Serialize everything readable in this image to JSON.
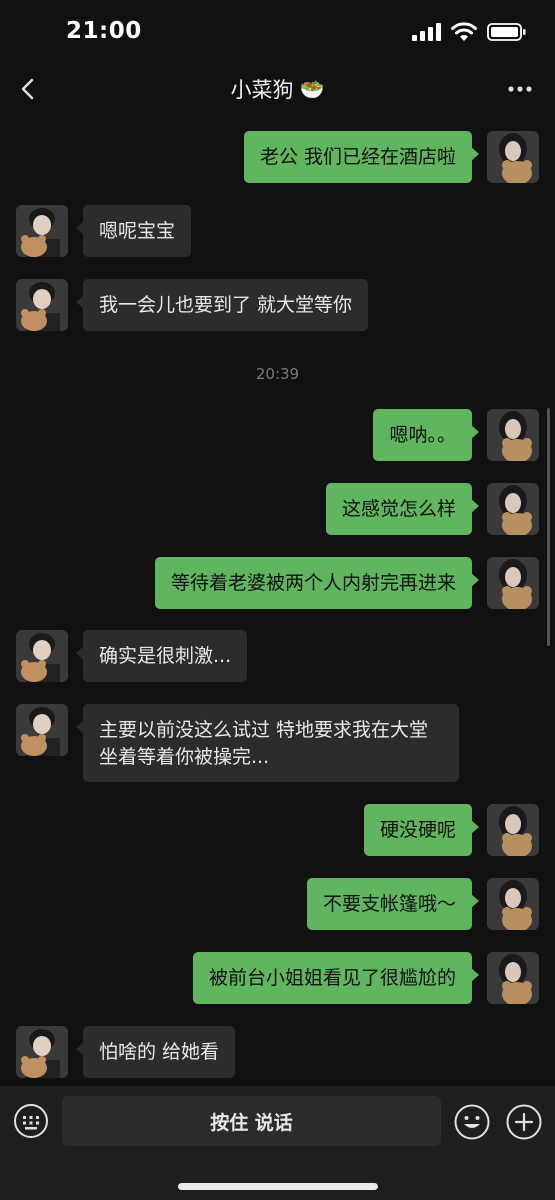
{
  "status_bar": {
    "time": "21:00"
  },
  "header": {
    "title": "小菜狗",
    "title_emoji": "🥗"
  },
  "timestamp": "20:39",
  "messages": [
    {
      "side": "out",
      "text": "老公 我们已经在酒店啦"
    },
    {
      "side": "in",
      "text": "嗯呢宝宝"
    },
    {
      "side": "in",
      "text": "我一会儿也要到了 就大堂等你"
    },
    {
      "side": "out",
      "text": "嗯呐。。"
    },
    {
      "side": "out",
      "text": "这感觉怎么样"
    },
    {
      "side": "out",
      "text": "等待着老婆被两个人内射完再进来"
    },
    {
      "side": "in",
      "text": "确实是很刺激..."
    },
    {
      "side": "in",
      "text": "主要以前没这么试过 特地要求我在大堂坐着等着你被操完..."
    },
    {
      "side": "out",
      "text": "硬没硬呢"
    },
    {
      "side": "out",
      "text": "不要支帐篷哦～"
    },
    {
      "side": "out",
      "text": "被前台小姐姐看见了很尴尬的"
    },
    {
      "side": "in",
      "text": "怕啥的 给她看"
    }
  ],
  "input_bar": {
    "voice_label": "按住 说话"
  },
  "icons": {
    "back": "chevron-left-icon",
    "more": "more-dots-icon",
    "keyboard": "keyboard-icon",
    "emoji": "emoji-icon",
    "plus": "plus-icon"
  },
  "colors": {
    "bubble_out": "#5fb65e",
    "bubble_in": "#2c2c2c",
    "background": "#111111"
  }
}
